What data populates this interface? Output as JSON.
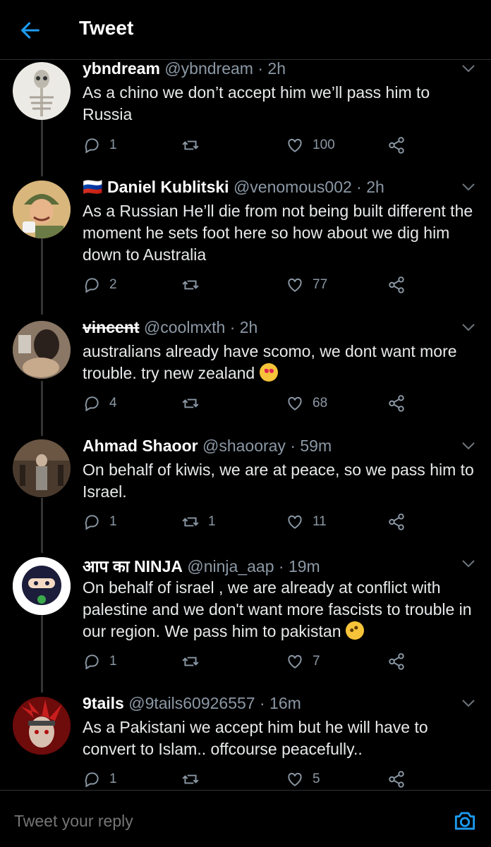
{
  "header": {
    "title": "Tweet"
  },
  "tweets": [
    {
      "name": "ybndream",
      "handle": "@ybndream",
      "time": "2h",
      "text": "As a chino we don’t accept him we’ll pass him to Russia",
      "replies": "1",
      "retweets": "",
      "likes": "100"
    },
    {
      "name": "🇷🇺 Daniel Kublitski",
      "handle": "@venomous002",
      "time": "2h",
      "text": "As a Russian He’ll die from not being built different the moment he sets foot here so how about we dig him down to Australia",
      "replies": "2",
      "retweets": "",
      "likes": "77"
    },
    {
      "name": "vincent",
      "handle": "@coolmxth",
      "time": "2h",
      "text": "australians already have scomo, we dont want more trouble. try new zealand",
      "emoji": "smiling-face-with-hearts",
      "replies": "4",
      "retweets": "",
      "likes": "68"
    },
    {
      "name": "Ahmad Shaoor",
      "handle": "@shaooray",
      "time": "59m",
      "text": "On behalf of kiwis, we are at peace, so we pass him to Israel.",
      "replies": "1",
      "retweets": "1",
      "likes": "11"
    },
    {
      "name": "आप का NINJA",
      "handle": "@ninja_aap",
      "time": "19m",
      "text": "On behalf of israel , we are already at conflict with palestine and we don't want more fascists to trouble in our region. We pass him to pakistan",
      "emoji": "rolling-on-floor-laughing",
      "replies": "1",
      "retweets": "",
      "likes": "7"
    },
    {
      "name": "9tails",
      "handle": "@9tails60926557",
      "time": "16m",
      "text": "As a Pakistani we accept him but he will have to convert to Islam.. offcourse peacefully..",
      "replies": "1",
      "retweets": "",
      "likes": "5"
    }
  ],
  "reply": {
    "placeholder": "Tweet your reply"
  },
  "colors": {
    "background": "#000000",
    "accent": "#1d9bf0",
    "muted": "#8b98a5",
    "text": "#e7e9ea"
  },
  "icons": {
    "back": "arrow-left-icon",
    "camera": "camera-icon",
    "reply": "reply-icon",
    "retweet": "retweet-icon",
    "like": "heart-icon",
    "share": "share-icon",
    "menu": "chevron-down-icon"
  }
}
